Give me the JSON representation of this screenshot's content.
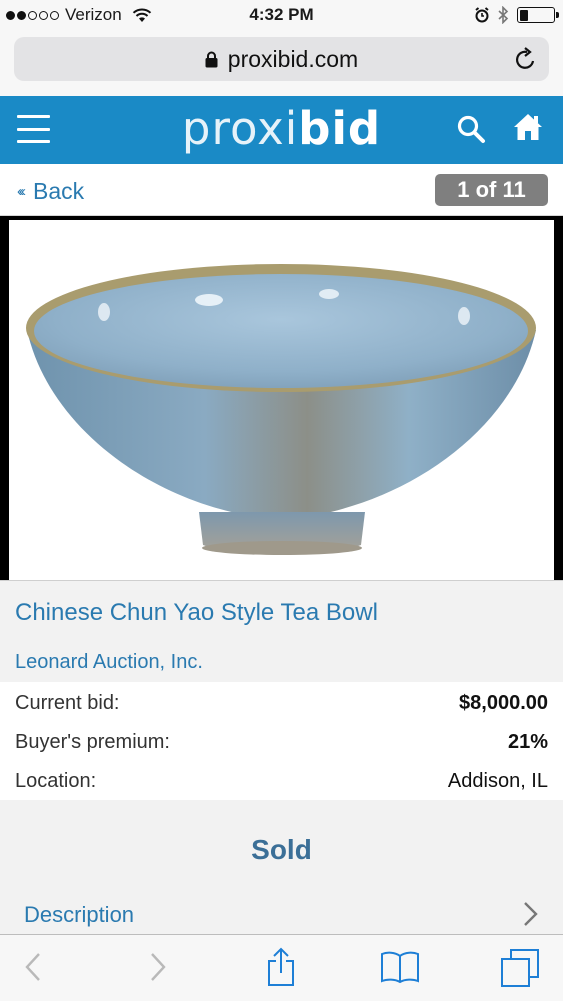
{
  "status_bar": {
    "carrier": "Verizon",
    "time": "4:32 PM",
    "signal_bars_filled": 2,
    "signal_bars_total": 5,
    "battery_level": 0.25
  },
  "browser": {
    "url": "proxibid.com"
  },
  "site": {
    "logo_prefix": "proxi",
    "logo_suffix": "bid",
    "brand_color": "#1a8ac6"
  },
  "nav": {
    "back_label": "Back",
    "counter": "1 of 11"
  },
  "lot": {
    "title": "Chinese Chun Yao Style Tea Bowl",
    "auctioneer": "Leonard Auction, Inc.",
    "details": [
      {
        "label": "Current bid:",
        "value": "$8,000.00",
        "bold": true
      },
      {
        "label": "Buyer's premium:",
        "value": "21%",
        "bold": true
      },
      {
        "label": "Location:",
        "value": "Addison, IL",
        "bold": false
      }
    ],
    "status": "Sold",
    "description_label": "Description"
  },
  "icons": {
    "menu": "hamburger-icon",
    "search": "search-icon",
    "home": "home-icon",
    "lock": "lock-icon",
    "reload": "reload-icon",
    "back": "back-chevron-icon",
    "forward": "forward-chevron-icon",
    "share": "share-icon",
    "bookmarks": "bookmarks-icon",
    "tabs": "tabs-icon"
  }
}
